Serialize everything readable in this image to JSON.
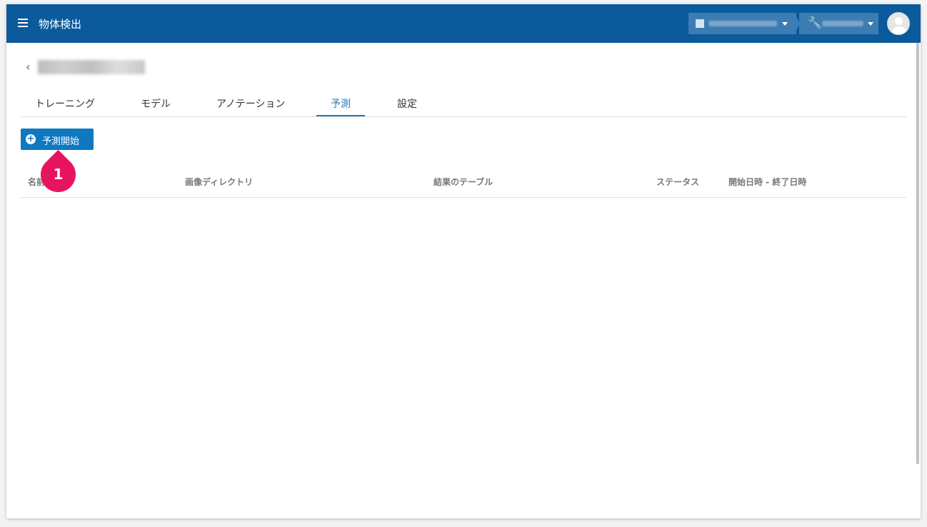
{
  "app": {
    "title": "物体検出"
  },
  "tabs": [
    {
      "label": "トレーニング"
    },
    {
      "label": "モデル"
    },
    {
      "label": "アノテーション"
    },
    {
      "label": "予測"
    },
    {
      "label": "設定"
    }
  ],
  "toolbar": {
    "start_label": "予測開始"
  },
  "table": {
    "headers": [
      "名前",
      "画像ディレクトリ",
      "結果のテーブル",
      "ステータス",
      "開始日時 - 終了日時"
    ]
  },
  "annotation": {
    "marker_label": "1"
  },
  "colors": {
    "appbar": "#0a5a9c",
    "accent": "#1e7bbf",
    "marker": "#e8135f"
  }
}
